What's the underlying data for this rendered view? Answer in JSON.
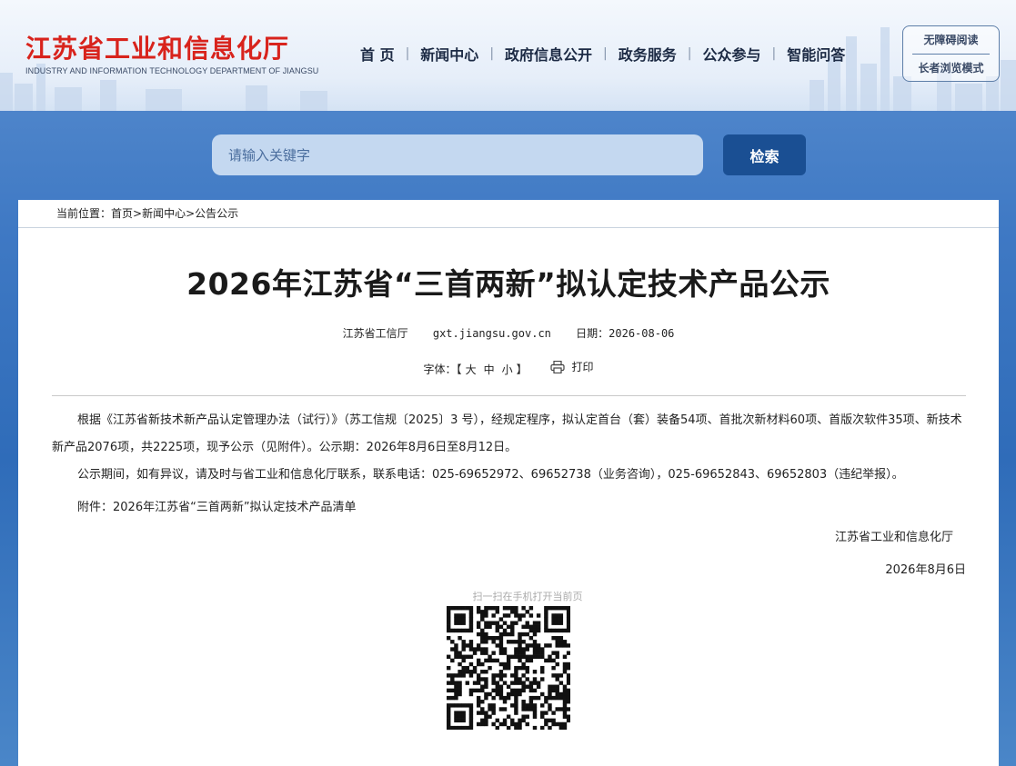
{
  "header": {
    "logo_cn": "江苏省工业和信息化厅",
    "logo_en": "INDUSTRY AND INFORMATION TECHNOLOGY DEPARTMENT OF JIANGSU",
    "nav": [
      "首 页",
      "新闻中心",
      "政府信息公开",
      "政务服务",
      "公众参与",
      "智能问答"
    ],
    "access_barrier_free": "无障碍阅读",
    "access_elder": "长者浏览模式"
  },
  "search": {
    "placeholder": "请输入关键字",
    "button": "检索"
  },
  "breadcrumb": {
    "prefix": "当前位置：",
    "items": [
      "首页",
      "新闻中心",
      "公告公示"
    ],
    "sep": ">"
  },
  "article": {
    "title": "2026年江苏省“三首两新”拟认定技术产品公示",
    "source": "江苏省工信厅",
    "site": "gxt.jiangsu.gov.cn",
    "date_label": "日期：",
    "date": "2026-08-06",
    "font_label": "字体：",
    "font_open": "【",
    "font_large": "大",
    "font_medium": "中",
    "font_small": "小",
    "font_close": "】",
    "print": "打印",
    "paragraphs": [
      "根据《江苏省新技术新产品认定管理办法（试行）》（苏工信规〔2025〕3 号），经规定程序，拟认定首台（套）装备54项、首批次新材料60项、首版次软件35项、新技术新产品2076项，共2225项，现予公示（见附件）。公示期：2026年8月6日至8月12日。",
      "公示期间，如有异议，请及时与省工业和信息化厅联系，联系电话：025-69652972、69652738（业务咨询），025-69652843、69652803（违纪举报）。",
      "附件：2026年江苏省“三首两新”拟认定技术产品清单"
    ],
    "signature": "江苏省工业和信息化厅",
    "sign_date": "2026年8月6日",
    "qr_caption": "扫一扫在手机打开当前页"
  }
}
